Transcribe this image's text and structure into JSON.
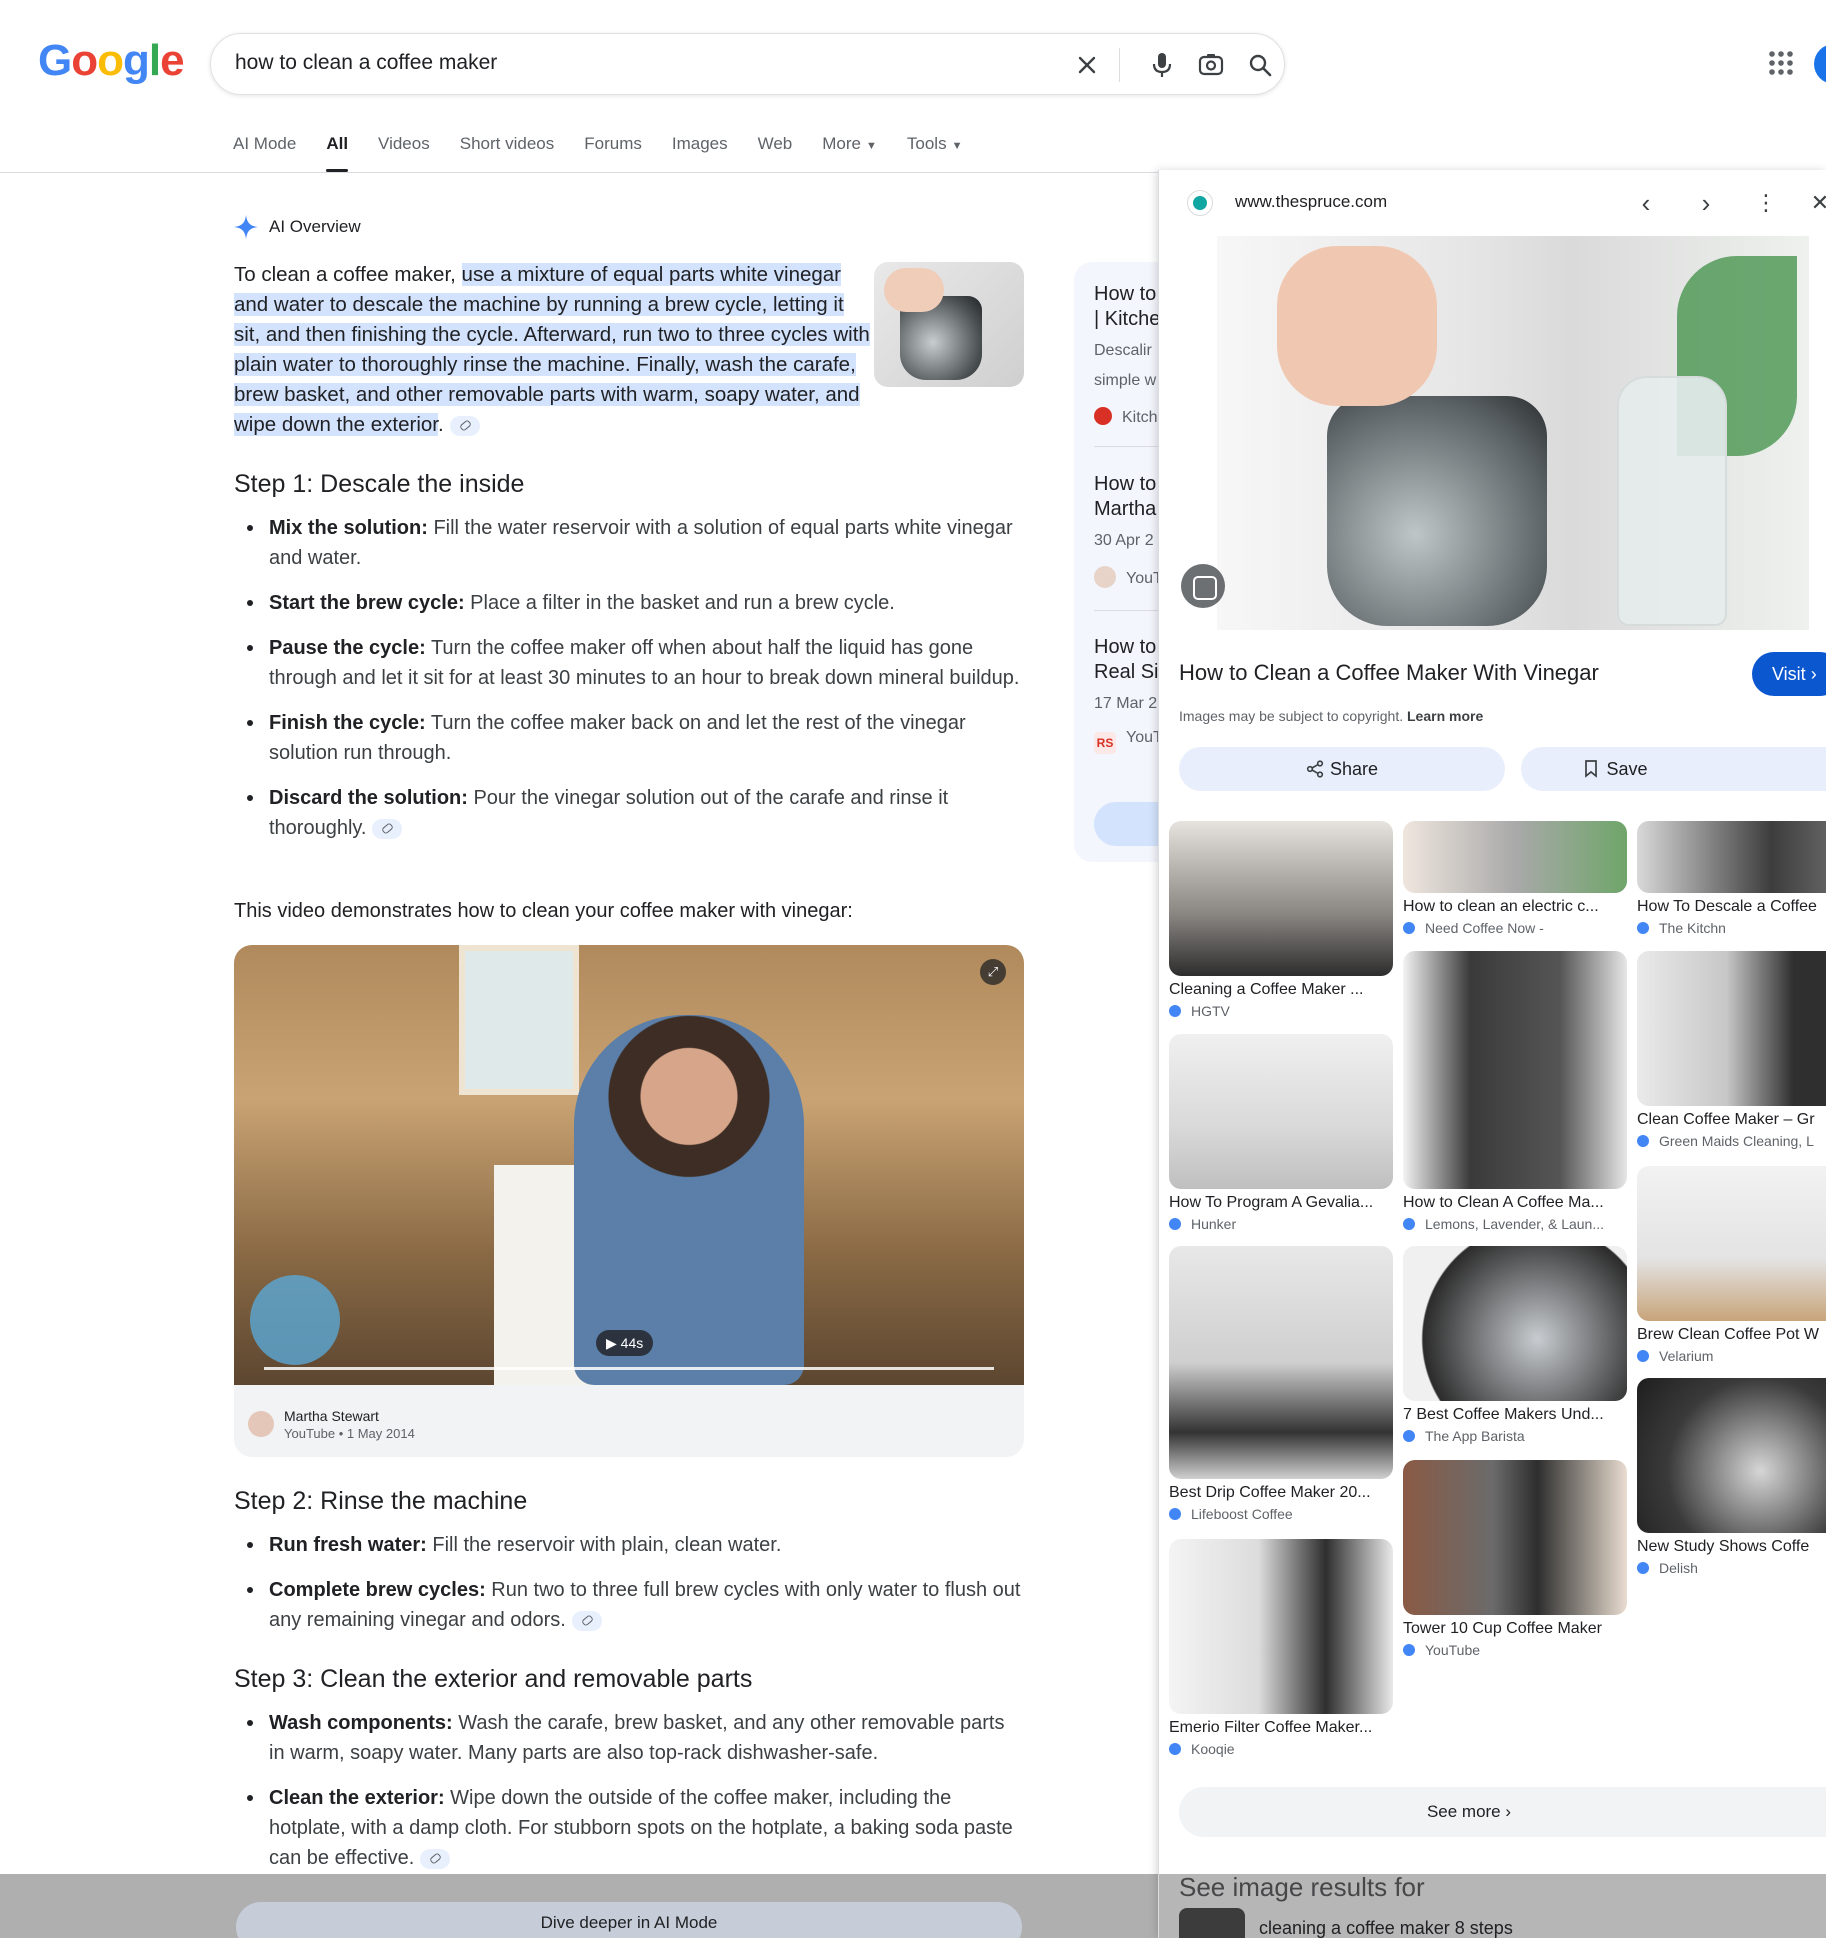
{
  "search": {
    "query": "how to clean a coffee maker"
  },
  "tabs": [
    {
      "label": "AI Mode"
    },
    {
      "label": "All",
      "active": true
    },
    {
      "label": "Videos"
    },
    {
      "label": "Short videos"
    },
    {
      "label": "Forums"
    },
    {
      "label": "Images"
    },
    {
      "label": "Web"
    },
    {
      "label": "More",
      "caret": true
    },
    {
      "label": "Tools",
      "caret": true
    }
  ],
  "ai_overview": {
    "heading": "AI Overview",
    "intro_plain": "To clean a coffee maker, ",
    "intro_highlight": "use a mixture of equal parts white vinegar and water to descale the machine by running a brew cycle, letting it sit, and then finishing the cycle. Afterward, run two to three cycles with plain water to thoroughly rinse the machine. Finally, wash the carafe, brew basket, and other removable parts with warm, soapy water, and wipe down the exterior",
    "intro_end": ".",
    "steps": [
      {
        "heading": "Step 1: Descale the inside",
        "bullets": [
          {
            "label": "Mix the solution:",
            "text": " Fill the water reservoir with a solution of equal parts white vinegar and water."
          },
          {
            "label": "Start the brew cycle:",
            "text": " Place a filter in the basket and run a brew cycle."
          },
          {
            "label": "Pause the cycle:",
            "text": " Turn the coffee maker off when about half the liquid has gone through and let it sit for at least 30 minutes to an hour to break down mineral buildup."
          },
          {
            "label": "Finish the cycle:",
            "text": " Turn the coffee maker back on and let the rest of the vinegar solution run through."
          },
          {
            "label": "Discard the solution:",
            "text": " Pour the vinegar solution out of the carafe and rinse it thoroughly.",
            "cite": true
          }
        ]
      },
      {
        "heading": "Step 2: Rinse the machine",
        "bullets": [
          {
            "label": "Run fresh water:",
            "text": " Fill the reservoir with plain, clean water."
          },
          {
            "label": "Complete brew cycles:",
            "text": " Run two to three full brew cycles with only water to flush out any remaining vinegar and odors.",
            "cite": true
          }
        ]
      },
      {
        "heading": "Step 3: Clean the exterior and removable parts",
        "bullets": [
          {
            "label": "Wash components:",
            "text": " Wash the carafe, brew basket, and any other removable parts in warm, soapy water. Many parts are also top-rack dishwasher-safe."
          },
          {
            "label": "Clean the exterior:",
            "text": " Wipe down the outside of the coffee maker, including the hotplate, with a damp cloth. For stubborn spots on the hotplate, a baking soda paste can be effective.",
            "cite": true
          }
        ]
      }
    ],
    "video_intro": "This video demonstrates how to clean your coffee maker with vinegar:",
    "video": {
      "duration": "44s",
      "channel": "Martha Stewart",
      "meta": "YouTube • 1 May 2014"
    },
    "dive_deeper": "Dive deeper in AI Mode"
  },
  "mid_column": {
    "items": [
      {
        "title1": "How to",
        "title2": "| Kitche",
        "snippet1": "Descalir",
        "snippet2": "simple w",
        "source": "Kitch"
      },
      {
        "title1": "How to",
        "title2": "Martha",
        "snippet1": "30 Apr 2",
        "source": "YouT"
      },
      {
        "title1": "How to",
        "title2": "Real Sir",
        "snippet1": "17 Mar 2",
        "source": "YouT"
      }
    ]
  },
  "panel": {
    "domain": "www.thespruce.com",
    "title": "How to Clean a Coffee Maker With Vinegar",
    "visit_label": "Visit",
    "copyright_text": "Images may be subject to copyright.",
    "learn_more": "Learn more",
    "share_label": "Share",
    "save_label": "Save",
    "see_more": "See more",
    "see_image_results": "See image results for",
    "image_result_query": "cleaning a coffee maker 8 steps",
    "related": [
      {
        "title": "Cleaning a Coffee Maker ...",
        "source": "HGTV"
      },
      {
        "title": "How To Program A Gevalia...",
        "source": "Hunker"
      },
      {
        "title": "Best Drip Coffee Maker 20...",
        "source": "Lifeboost Coffee"
      },
      {
        "title": "Emerio Filter Coffee Maker...",
        "source": "Kooqie"
      },
      {
        "title": "How to clean an electric c...",
        "source": "Need Coffee Now -"
      },
      {
        "title": "How to Clean A Coffee Ma...",
        "source": "Lemons, Lavender, & Laun..."
      },
      {
        "title": "7 Best Coffee Makers Und...",
        "source": "The App Barista"
      },
      {
        "title": "Tower 10 Cup Coffee Maker",
        "source": "YouTube"
      },
      {
        "title": "How To Descale a Coffee",
        "source": "The Kitchn"
      },
      {
        "title": "Clean Coffee Maker – Gr",
        "source": "Green Maids Cleaning, L"
      },
      {
        "title": "Brew Clean Coffee Pot W",
        "source": "Velarium"
      },
      {
        "title": "New Study Shows Coffe",
        "source": "Delish"
      }
    ]
  },
  "colors": {
    "highlight": "#d3e3fd",
    "visit_button": "#0b57d0",
    "ai_star": "#4285f4"
  }
}
